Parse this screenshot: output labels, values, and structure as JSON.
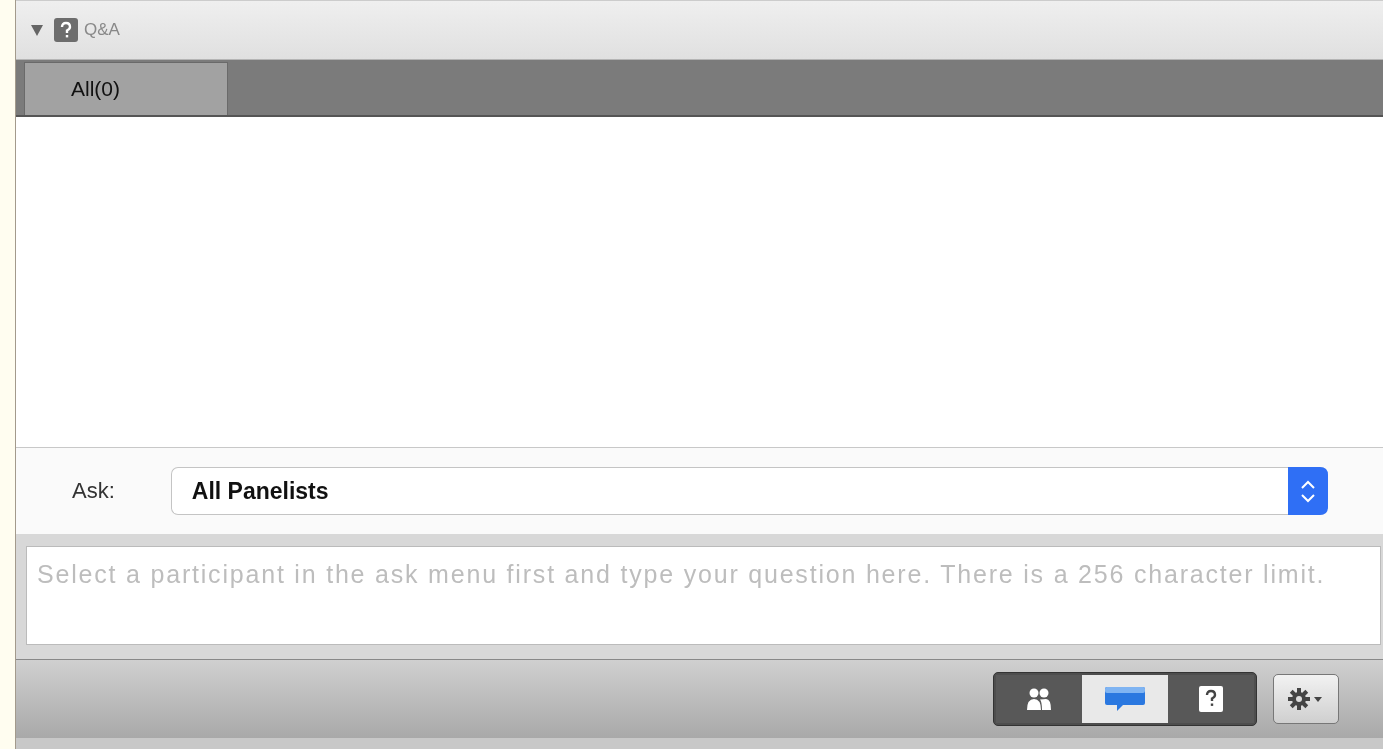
{
  "panel": {
    "title": "Q&A",
    "expanded": true
  },
  "tabs": [
    {
      "label": "All(0)",
      "selected": true
    }
  ],
  "ask": {
    "label": "Ask:",
    "value": "All Panelists"
  },
  "question": {
    "placeholder": "Select a participant in the ask menu first and type your question here. There is a 256 character limit."
  },
  "view_switcher": [
    {
      "kind": "participants",
      "selected": false
    },
    {
      "kind": "chat",
      "selected": true
    },
    {
      "kind": "qa",
      "selected": false
    }
  ]
}
